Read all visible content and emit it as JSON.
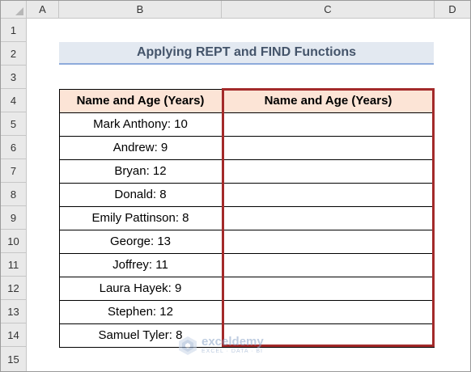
{
  "columns": [
    "A",
    "B",
    "C",
    "D"
  ],
  "rows": [
    "1",
    "2",
    "3",
    "4",
    "5",
    "6",
    "7",
    "8",
    "9",
    "10",
    "11",
    "12",
    "13",
    "14",
    "15"
  ],
  "title": "Applying REPT and FIND Functions",
  "table": {
    "header_b": "Name and Age (Years)",
    "header_c": "Name and Age (Years)",
    "entries": [
      "Mark Anthony: 10",
      "Andrew: 9",
      "Bryan: 12",
      "Donald: 8",
      "Emily Pattinson: 8",
      "George: 13",
      "Joffrey: 11",
      "Laura Hayek: 9",
      "Stephen: 12",
      "Samuel Tyler: 8"
    ]
  },
  "watermark": {
    "name": "exceldemy",
    "tagline": "EXCEL · DATA · BI",
    "icon": "exceldemy-logo-icon"
  },
  "colors": {
    "header_fill": "#fce4d6",
    "title_fill": "#e3e9f1",
    "title_text": "#44546a",
    "highlight_border": "#a32a2a"
  }
}
